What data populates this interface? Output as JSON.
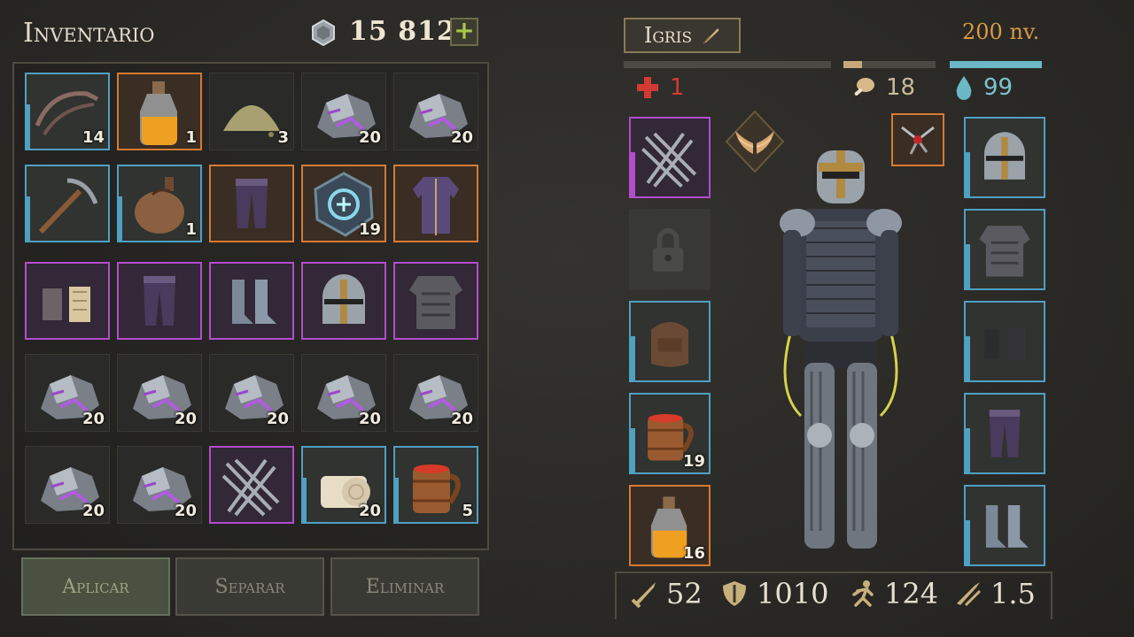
{
  "header": {
    "title": "Inventario",
    "coins": "15  812",
    "add_label": "+"
  },
  "inventory": {
    "slots": [
      {
        "name": "grappling-hook",
        "qty": "14",
        "rarity": "blue",
        "icon": "hook-icon"
      },
      {
        "name": "fire-potion",
        "qty": "1",
        "rarity": "orange",
        "icon": "potion-icon"
      },
      {
        "name": "sulfur-powder",
        "qty": "3",
        "rarity": "none",
        "icon": "powder-icon"
      },
      {
        "name": "dark-ore",
        "qty": "20",
        "rarity": "none",
        "icon": "ore-icon"
      },
      {
        "name": "dark-ore",
        "qty": "20",
        "rarity": "none",
        "icon": "ore-icon"
      },
      {
        "name": "pickaxe",
        "qty": "",
        "rarity": "blue",
        "icon": "pickaxe-icon"
      },
      {
        "name": "water-flask",
        "qty": "1",
        "rarity": "blue",
        "icon": "flask-icon"
      },
      {
        "name": "purple-pants",
        "qty": "",
        "rarity": "orange",
        "icon": "pants-icon"
      },
      {
        "name": "rune-stone",
        "qty": "19",
        "rarity": "orange",
        "icon": "rune-icon"
      },
      {
        "name": "purple-robe",
        "qty": "",
        "rarity": "orange",
        "icon": "robe-icon"
      },
      {
        "name": "plated-gauntlets",
        "qty": "",
        "rarity": "purple",
        "icon": "gauntlets-icon"
      },
      {
        "name": "leather-pants",
        "qty": "",
        "rarity": "purple",
        "icon": "pants-icon"
      },
      {
        "name": "steel-boots",
        "qty": "",
        "rarity": "purple",
        "icon": "boots-icon"
      },
      {
        "name": "golden-helmet",
        "qty": "",
        "rarity": "purple",
        "icon": "helmet-icon"
      },
      {
        "name": "golden-armor",
        "qty": "",
        "rarity": "purple",
        "icon": "armor-icon"
      },
      {
        "name": "dark-ore",
        "qty": "20",
        "rarity": "none",
        "icon": "ore-icon"
      },
      {
        "name": "dark-ore",
        "qty": "20",
        "rarity": "none",
        "icon": "ore-icon"
      },
      {
        "name": "dark-ore",
        "qty": "20",
        "rarity": "none",
        "icon": "ore-icon"
      },
      {
        "name": "dark-ore",
        "qty": "20",
        "rarity": "none",
        "icon": "ore-icon"
      },
      {
        "name": "dark-ore",
        "qty": "20",
        "rarity": "none",
        "icon": "ore-icon"
      },
      {
        "name": "dark-ore",
        "qty": "20",
        "rarity": "none",
        "icon": "ore-icon"
      },
      {
        "name": "dark-ore",
        "qty": "20",
        "rarity": "none",
        "icon": "ore-icon"
      },
      {
        "name": "claws",
        "qty": "",
        "rarity": "purple",
        "icon": "claws-icon"
      },
      {
        "name": "cloth-roll",
        "qty": "20",
        "rarity": "blue",
        "icon": "cloth-icon"
      },
      {
        "name": "ale-mug",
        "qty": "5",
        "rarity": "blue",
        "icon": "mug-icon"
      }
    ]
  },
  "buttons": {
    "apply": "Aplicar",
    "split": "Separar",
    "delete": "Eliminar"
  },
  "character": {
    "name": "Igris",
    "level": "200 nv.",
    "health": "1",
    "hunger": "18",
    "thirst": "99",
    "health_fill": 0.0,
    "hunger_fill": 0.2,
    "thirst_fill": 1.0,
    "colors": {
      "health": "#d23a32",
      "hunger": "#c8a878",
      "thirst": "#6bb8c6",
      "level": "#d99a44"
    }
  },
  "equipment": {
    "left": [
      {
        "name": "weapon-claws",
        "qty": "",
        "rarity": "purple",
        "icon": "claws-icon"
      },
      {
        "name": "locked-slot",
        "qty": "",
        "rarity": "locked",
        "icon": "lock-icon"
      },
      {
        "name": "backpack",
        "qty": "",
        "rarity": "blue",
        "icon": "backpack-icon"
      },
      {
        "name": "ale-mug",
        "qty": "19",
        "rarity": "blue",
        "icon": "mug-icon"
      },
      {
        "name": "mana-potion",
        "qty": "16",
        "rarity": "orange",
        "icon": "potion-icon"
      }
    ],
    "right": [
      {
        "name": "helmet",
        "rarity": "blue",
        "icon": "helmet-icon"
      },
      {
        "name": "chest-armor",
        "rarity": "blue",
        "icon": "armor-icon"
      },
      {
        "name": "gloves",
        "rarity": "blue",
        "icon": "gloves-icon"
      },
      {
        "name": "leg-armor",
        "rarity": "blue",
        "icon": "pants-icon"
      },
      {
        "name": "boots",
        "rarity": "blue",
        "icon": "boots-icon"
      }
    ]
  },
  "bottom_stats": {
    "attack": "52",
    "defense": "1010",
    "speed": "124",
    "crit": "1.5"
  }
}
